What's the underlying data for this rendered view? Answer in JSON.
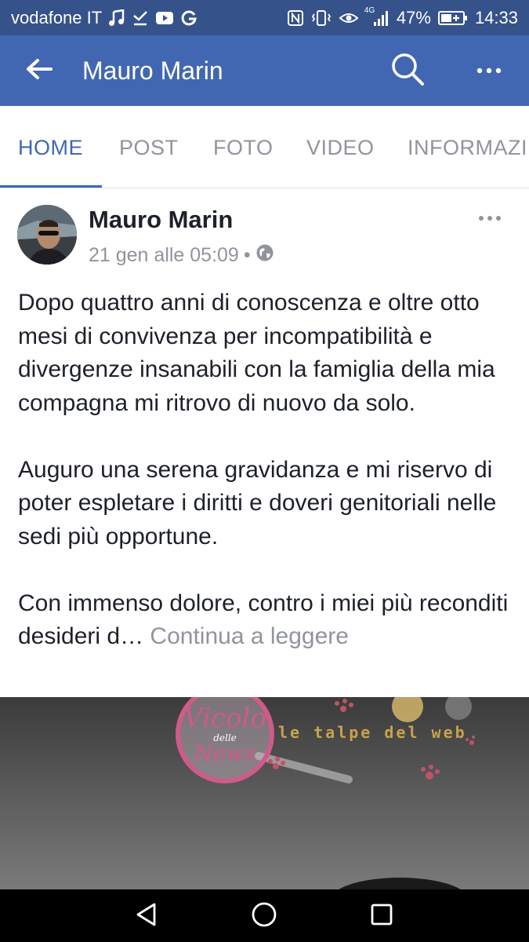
{
  "status_bar": {
    "carrier": "vodafone IT",
    "network": "4G",
    "battery": "47%",
    "time": "14:33",
    "icons": [
      "music-note-icon",
      "download-done-icon",
      "youtube-icon",
      "google-icon",
      "nfc-icon",
      "vibrate-icon",
      "eye-icon",
      "signal-icon",
      "battery-icon"
    ]
  },
  "app_bar": {
    "title": "Mauro Marin",
    "icons": [
      "back-arrow-icon",
      "search-icon",
      "more-icon"
    ]
  },
  "tabs": [
    "HOME",
    "POST",
    "FOTO",
    "VIDEO",
    "INFORMAZI"
  ],
  "active_tab": "HOME",
  "post": {
    "author": "Mauro Marin",
    "timestamp": "21 gen alle 05:09",
    "separator": "•",
    "privacy_icon": "globe-icon",
    "paragraphs": [
      "Dopo quattro anni di conoscenza e oltre otto mesi di convivenza per incompatibilità e divergenze insanabili con la famiglia della mia compagna mi ritrovo di nuovo da solo.",
      "Auguro una serena gravidanza e mi riservo di poter espletare i diritti e doveri genitoriali nelle sedi più opportune.",
      "Con immenso dolore, contro i miei più reconditi desideri d…"
    ],
    "continue_label": "Continua a leggere"
  },
  "watermark": {
    "logo_lines": [
      "Vicolo",
      "delle",
      "News"
    ],
    "site_label": "le talpe del web"
  },
  "colors": {
    "status_bar": "#36528a",
    "brand_blue": "#4267b2",
    "tab_inactive": "#90949c",
    "text": "#1d2129",
    "meta_gray": "#90949c"
  }
}
